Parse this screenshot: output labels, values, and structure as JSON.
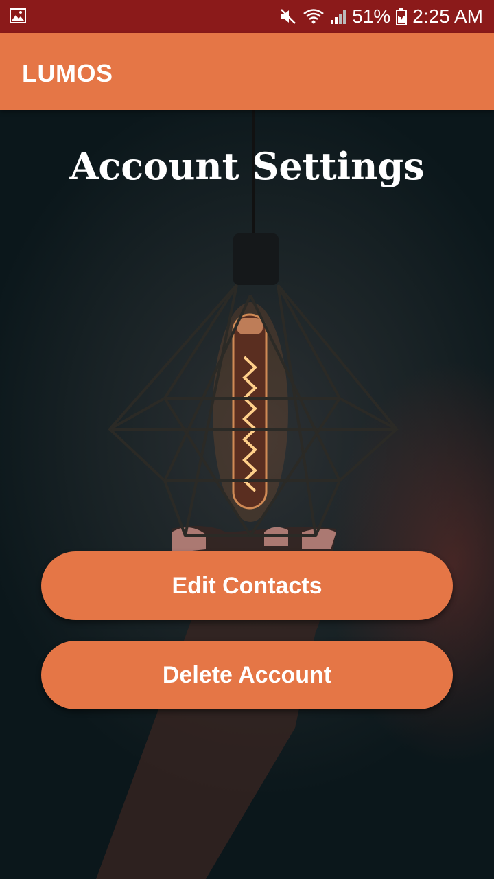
{
  "status_bar": {
    "battery": "51%",
    "time": "2:25 AM",
    "icons": [
      "gallery-icon",
      "mute-icon",
      "wifi-icon",
      "signal-icon",
      "battery-icon"
    ],
    "background": "#8b1a1a"
  },
  "app_bar": {
    "title": "LUMOS",
    "color": "#e57646"
  },
  "main": {
    "title": "Account Settings",
    "buttons": {
      "edit_contacts": "Edit Contacts",
      "delete_account": "Delete Account"
    },
    "background_image": "hanging-lamp-photo"
  }
}
